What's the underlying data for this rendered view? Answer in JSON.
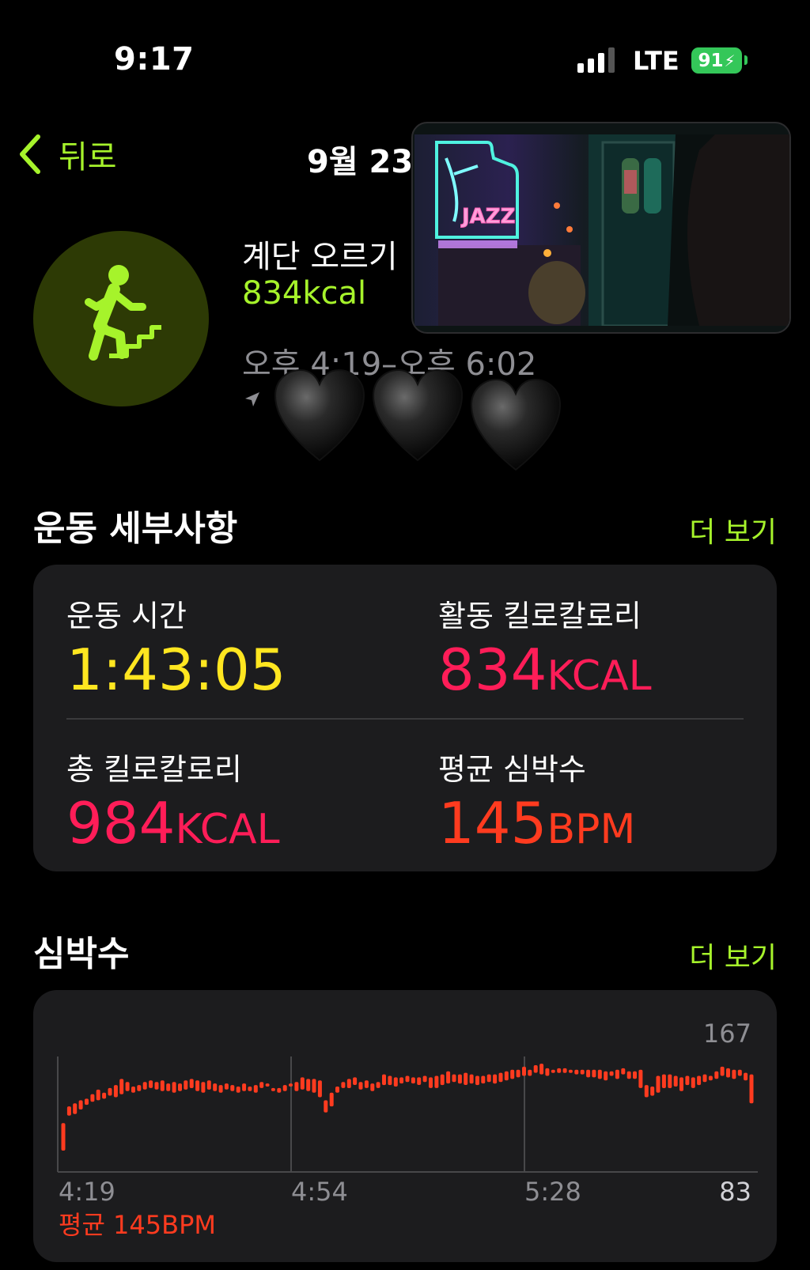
{
  "status_bar": {
    "time": "9:17",
    "network": "LTE",
    "battery": "91"
  },
  "nav": {
    "back_label": "뒤로",
    "title": "9월 23"
  },
  "workout": {
    "name": "계단 오르기",
    "kcal": "834kcal",
    "time_range": "오후 4:19–오후 6:02",
    "icon": "stair-climbing-icon"
  },
  "details": {
    "title": "운동 세부사항",
    "more": "더 보기",
    "metrics": [
      {
        "label": "운동 시간",
        "value": "1:43:05",
        "unit": "",
        "color": "#ffe620"
      },
      {
        "label": "활동 킬로칼로리",
        "value": "834",
        "unit": "KCAL",
        "color": "#ff1d58"
      },
      {
        "label": "총 킬로칼로리",
        "value": "984",
        "unit": "KCAL",
        "color": "#ff1d58"
      },
      {
        "label": "평균 심박수",
        "value": "145",
        "unit": "BPM",
        "color": "#ff3b1f"
      }
    ]
  },
  "heart_rate": {
    "title": "심박수",
    "more": "더 보기",
    "max_label": "167",
    "min_label": "83",
    "time_labels": [
      "4:19",
      "4:54",
      "5:28"
    ],
    "average": "평균 145BPM"
  },
  "chart_data": {
    "type": "bar",
    "ylim": [
      83,
      167
    ],
    "x_ticks": [
      "4:19",
      "4:54",
      "5:28"
    ],
    "series": [
      {
        "values": [
          [
            97,
            115
          ],
          [
            120,
            126
          ],
          [
            121,
            128
          ],
          [
            124,
            130
          ],
          [
            127,
            131
          ],
          [
            129,
            134
          ],
          [
            130,
            137
          ],
          [
            131,
            135
          ],
          [
            133,
            138
          ],
          [
            132,
            140
          ],
          [
            134,
            144
          ],
          [
            136,
            142
          ],
          [
            135,
            139
          ],
          [
            136,
            140
          ],
          [
            137,
            142
          ],
          [
            138,
            143
          ],
          [
            137,
            142
          ],
          [
            136,
            143
          ],
          [
            136,
            141
          ],
          [
            135,
            142
          ],
          [
            136,
            141
          ],
          [
            137,
            143
          ],
          [
            138,
            144
          ],
          [
            136,
            143
          ],
          [
            135,
            142
          ],
          [
            137,
            143
          ],
          [
            136,
            141
          ],
          [
            135,
            140
          ],
          [
            137,
            141
          ],
          [
            136,
            140
          ],
          [
            135,
            139
          ],
          [
            136,
            141
          ],
          [
            136,
            139
          ],
          [
            135,
            140
          ],
          [
            138,
            142
          ],
          [
            139,
            141
          ],
          [
            136,
            138
          ],
          [
            135,
            138
          ],
          [
            136,
            140
          ],
          [
            139,
            141
          ],
          [
            136,
            142
          ],
          [
            137,
            145
          ],
          [
            136,
            144
          ],
          [
            135,
            144
          ],
          [
            132,
            143
          ],
          [
            122,
            130
          ],
          [
            126,
            135
          ],
          [
            135,
            139
          ],
          [
            138,
            142
          ],
          [
            138,
            144
          ],
          [
            140,
            145
          ],
          [
            137,
            142
          ],
          [
            138,
            143
          ],
          [
            136,
            141
          ],
          [
            138,
            142
          ],
          [
            140,
            147
          ],
          [
            140,
            146
          ],
          [
            139,
            145
          ],
          [
            141,
            145
          ],
          [
            142,
            146
          ],
          [
            141,
            145
          ],
          [
            140,
            145
          ],
          [
            142,
            146
          ],
          [
            138,
            145
          ],
          [
            138,
            146
          ],
          [
            140,
            147
          ],
          [
            141,
            149
          ],
          [
            142,
            147
          ],
          [
            141,
            147
          ],
          [
            140,
            148
          ],
          [
            141,
            147
          ],
          [
            140,
            146
          ],
          [
            141,
            146
          ],
          [
            142,
            147
          ],
          [
            141,
            147
          ],
          [
            142,
            148
          ],
          [
            143,
            149
          ],
          [
            144,
            150
          ],
          [
            145,
            150
          ],
          [
            146,
            152
          ],
          [
            146,
            150
          ],
          [
            148,
            153
          ],
          [
            147,
            154
          ],
          [
            146,
            151
          ],
          [
            148,
            150
          ],
          [
            148,
            151
          ],
          [
            148,
            151
          ],
          [
            148,
            150
          ],
          [
            147,
            150
          ],
          [
            147,
            150
          ],
          [
            145,
            150
          ],
          [
            145,
            150
          ],
          [
            144,
            150
          ],
          [
            143,
            149
          ],
          [
            146,
            149
          ],
          [
            144,
            150
          ],
          [
            147,
            151
          ],
          [
            144,
            149
          ],
          [
            144,
            149
          ],
          [
            138,
            150
          ],
          [
            132,
            140
          ],
          [
            133,
            139
          ],
          [
            135,
            146
          ],
          [
            138,
            147
          ],
          [
            138,
            147
          ],
          [
            139,
            146
          ],
          [
            136,
            145
          ],
          [
            140,
            146
          ],
          [
            138,
            145
          ],
          [
            140,
            146
          ],
          [
            142,
            147
          ],
          [
            143,
            146
          ],
          [
            144,
            149
          ],
          [
            146,
            152
          ],
          [
            145,
            151
          ],
          [
            144,
            150
          ],
          [
            146,
            150
          ],
          [
            143,
            148
          ],
          [
            128,
            147
          ]
        ]
      }
    ]
  }
}
